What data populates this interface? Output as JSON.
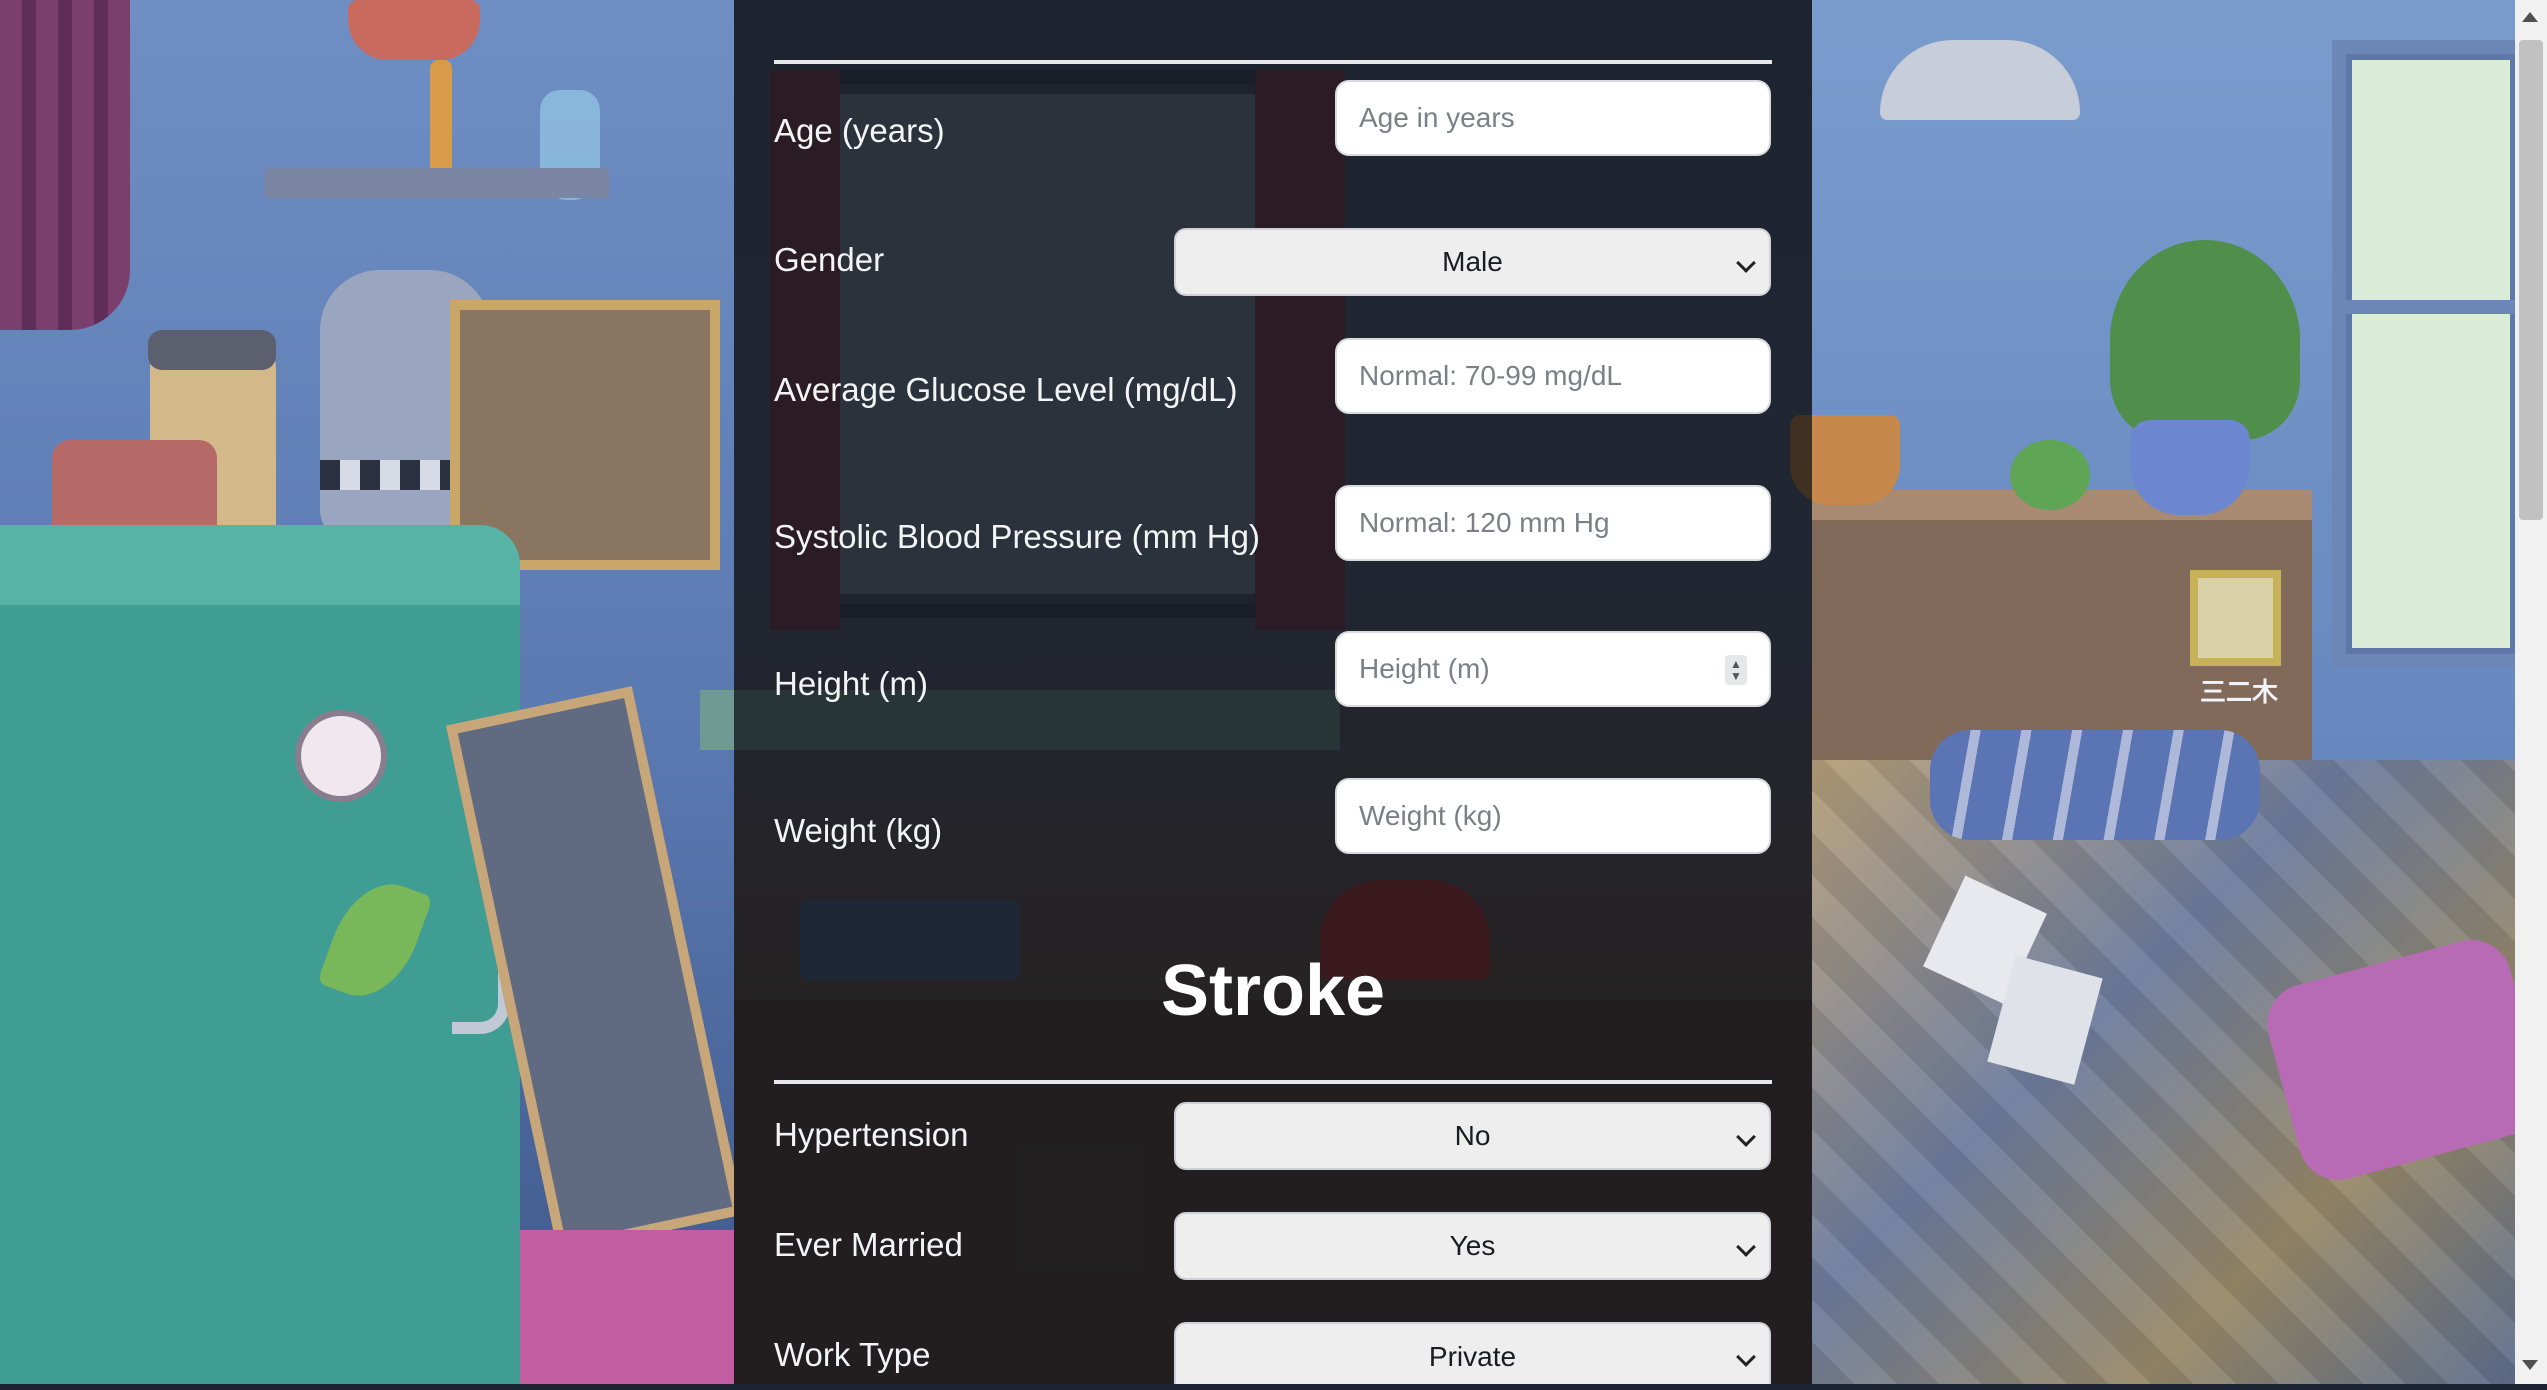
{
  "form": {
    "age": {
      "label": "Age (years)",
      "placeholder": "Age in years"
    },
    "gender": {
      "label": "Gender",
      "value": "Male"
    },
    "glucose": {
      "label": "Average Glucose Level (mg/dL)",
      "placeholder": "Normal: 70-99 mg/dL"
    },
    "systolic": {
      "label": "Systolic Blood Pressure (mm Hg)",
      "placeholder": "Normal: 120 mm Hg"
    },
    "height": {
      "label": "Height (m)",
      "placeholder": "Height (m)"
    },
    "weight": {
      "label": "Weight (kg)",
      "placeholder": "Weight (kg)"
    }
  },
  "stroke_section": {
    "title": "Stroke",
    "hypertension": {
      "label": "Hypertension",
      "value": "No"
    },
    "ever_married": {
      "label": "Ever Married",
      "value": "Yes"
    },
    "work_type": {
      "label": "Work Type",
      "value": "Private"
    }
  },
  "background": {
    "watermark": "三二木"
  },
  "icons": [
    "chevron-down-icon",
    "spinner-icon"
  ],
  "colors": {
    "panel": "#0c0e12",
    "text": "#f3f4f6",
    "input_bg": "#ffffff",
    "select_bg": "#eeeeef"
  }
}
